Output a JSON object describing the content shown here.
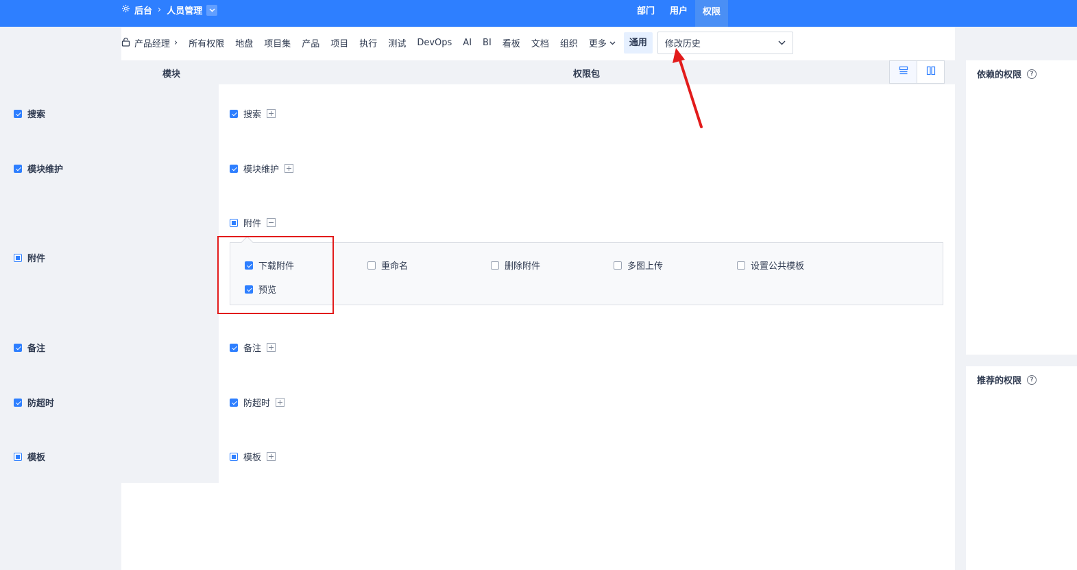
{
  "header": {
    "breadcrumb": {
      "home": "后台",
      "current": "人员管理"
    },
    "nav": [
      {
        "label": "部门"
      },
      {
        "label": "用户"
      },
      {
        "label": "权限"
      }
    ]
  },
  "toolbar": {
    "role": "产品经理",
    "items": [
      "所有权限",
      "地盘",
      "项目集",
      "产品",
      "项目",
      "执行",
      "测试",
      "DevOps",
      "AI",
      "BI",
      "看板",
      "文档",
      "组织"
    ],
    "more": "更多",
    "general": "通用",
    "history": "修改历史"
  },
  "table": {
    "col_module": "模块",
    "col_package": "权限包"
  },
  "modules": [
    {
      "name": "搜索",
      "state": "checked",
      "package": "搜索",
      "pkg_state": "checked",
      "expanded": false
    },
    {
      "name": "模块维护",
      "state": "checked",
      "package": "模块维护",
      "pkg_state": "checked",
      "expanded": false
    },
    {
      "name": "附件",
      "state": "partial",
      "package": "附件",
      "pkg_state": "partial",
      "expanded": true,
      "sub_items": [
        {
          "label": "下载附件",
          "checked": true
        },
        {
          "label": "重命名",
          "checked": false
        },
        {
          "label": "删除附件",
          "checked": false
        },
        {
          "label": "多图上传",
          "checked": false
        },
        {
          "label": "设置公共模板",
          "checked": false
        },
        {
          "label": "预览",
          "checked": true
        }
      ]
    },
    {
      "name": "备注",
      "state": "checked",
      "package": "备注",
      "pkg_state": "checked",
      "expanded": false
    },
    {
      "name": "防超时",
      "state": "checked",
      "package": "防超时",
      "pkg_state": "checked",
      "expanded": false
    },
    {
      "name": "模板",
      "state": "partial",
      "package": "模板",
      "pkg_state": "partial",
      "expanded": false
    }
  ],
  "side": {
    "depend_title": "依赖的权限",
    "recommend_title": "推荐的权限"
  },
  "colors": {
    "primary": "#2e7fff",
    "annotation": "#e21b1b"
  }
}
